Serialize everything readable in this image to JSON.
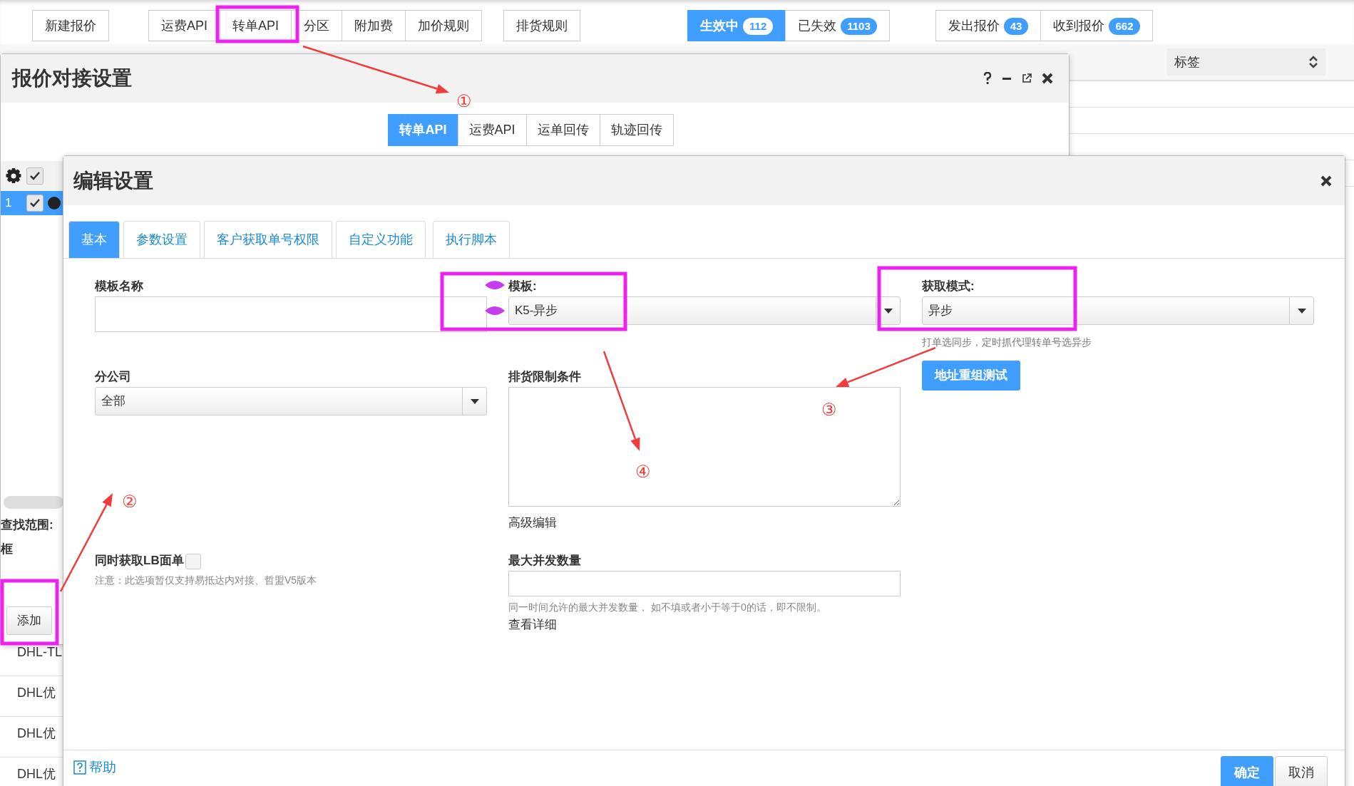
{
  "toolbar": {
    "new_button": "新建报价",
    "groups": [
      [
        "运费API",
        "转单API",
        "分区",
        "附加费",
        "加价规则"
      ],
      [
        "排货规则"
      ]
    ],
    "status_filters": [
      {
        "label": "生效中",
        "count": "112",
        "selected": true
      },
      {
        "label": "已失效",
        "count": "1103",
        "selected": false
      }
    ],
    "quote_filters": [
      {
        "label": "发出报价",
        "count": "43",
        "selected": false
      },
      {
        "label": "收到报价",
        "count": "662",
        "selected": false
      }
    ]
  },
  "background_table": {
    "column_select": "标签",
    "rows": [
      "DHL-TL",
      "DHL优",
      "DHL优",
      "DHL优"
    ]
  },
  "quote_settings_dialog": {
    "title": "报价对接设置",
    "tabs": [
      {
        "label": "转单API",
        "selected": true
      },
      {
        "label": "运费API",
        "selected": false
      },
      {
        "label": "运单回传",
        "selected": false
      },
      {
        "label": "轨迹回传",
        "selected": false
      }
    ],
    "grid": {
      "header_checked": true,
      "rows": [
        {
          "number": "1",
          "checked": true,
          "selected": true
        }
      ]
    },
    "search_label": "查找范围:",
    "search_text": "框",
    "add_button": "添加"
  },
  "edit_dialog": {
    "title": "编辑设置",
    "tabs": [
      {
        "label": "基本",
        "selected": true
      },
      {
        "label": "参数设置",
        "selected": false
      },
      {
        "label": "客户获取单号权限",
        "selected": false
      },
      {
        "label": "自定义功能",
        "selected": false
      },
      {
        "label": "执行脚本",
        "selected": false
      }
    ],
    "template_name": {
      "label": "模板名称"
    },
    "template": {
      "label": "模板:",
      "value": "K5-异步"
    },
    "mode": {
      "label": "获取模式:",
      "value": "异步",
      "hint": "打单选同步，定时抓代理转单号选异步"
    },
    "branch": {
      "label": "分公司",
      "value": "全部"
    },
    "restriction": {
      "label": "排货限制条件",
      "link": "高级编辑"
    },
    "test_button": "地址重组测试",
    "lb": {
      "label": "同时获取LB面单",
      "checked": false,
      "note": "注意：此选项暂仅支持易抵达内对接、哲盟V5版本"
    },
    "concurrency": {
      "label": "最大并发数量",
      "hint": "同一时间允许的最大并发数量， 如不填或者小于等于0的话，即不限制。",
      "link": "查看详细"
    },
    "help": "帮助",
    "buttons": [
      {
        "label": "确定",
        "kind": "primary"
      },
      {
        "label": "取消",
        "kind": "default"
      }
    ]
  },
  "annotations": {
    "callouts": [
      "①",
      "②",
      "③",
      "④"
    ]
  }
}
